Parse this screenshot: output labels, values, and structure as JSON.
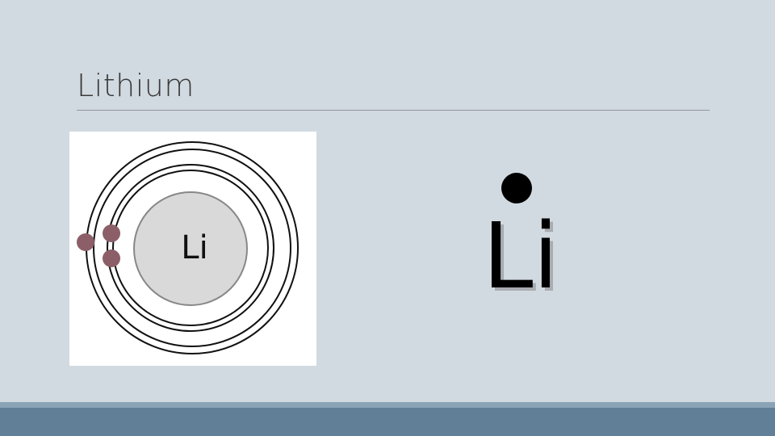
{
  "slide": {
    "title": "Lithium"
  },
  "bohr_model": {
    "nucleus_label": "Li",
    "shells": [
      {
        "shell": 1,
        "electrons": 2
      },
      {
        "shell": 2,
        "electrons": 1
      }
    ],
    "colors": {
      "nucleus_fill": "#d9d9d9",
      "nucleus_stroke": "#888888",
      "orbit_stroke": "#111111",
      "electron": "#8c5f68"
    }
  },
  "lewis_structure": {
    "symbol": "Li",
    "valence_electrons": 1
  },
  "theme": {
    "background": "#d2dae1",
    "footer": "#617f96"
  }
}
